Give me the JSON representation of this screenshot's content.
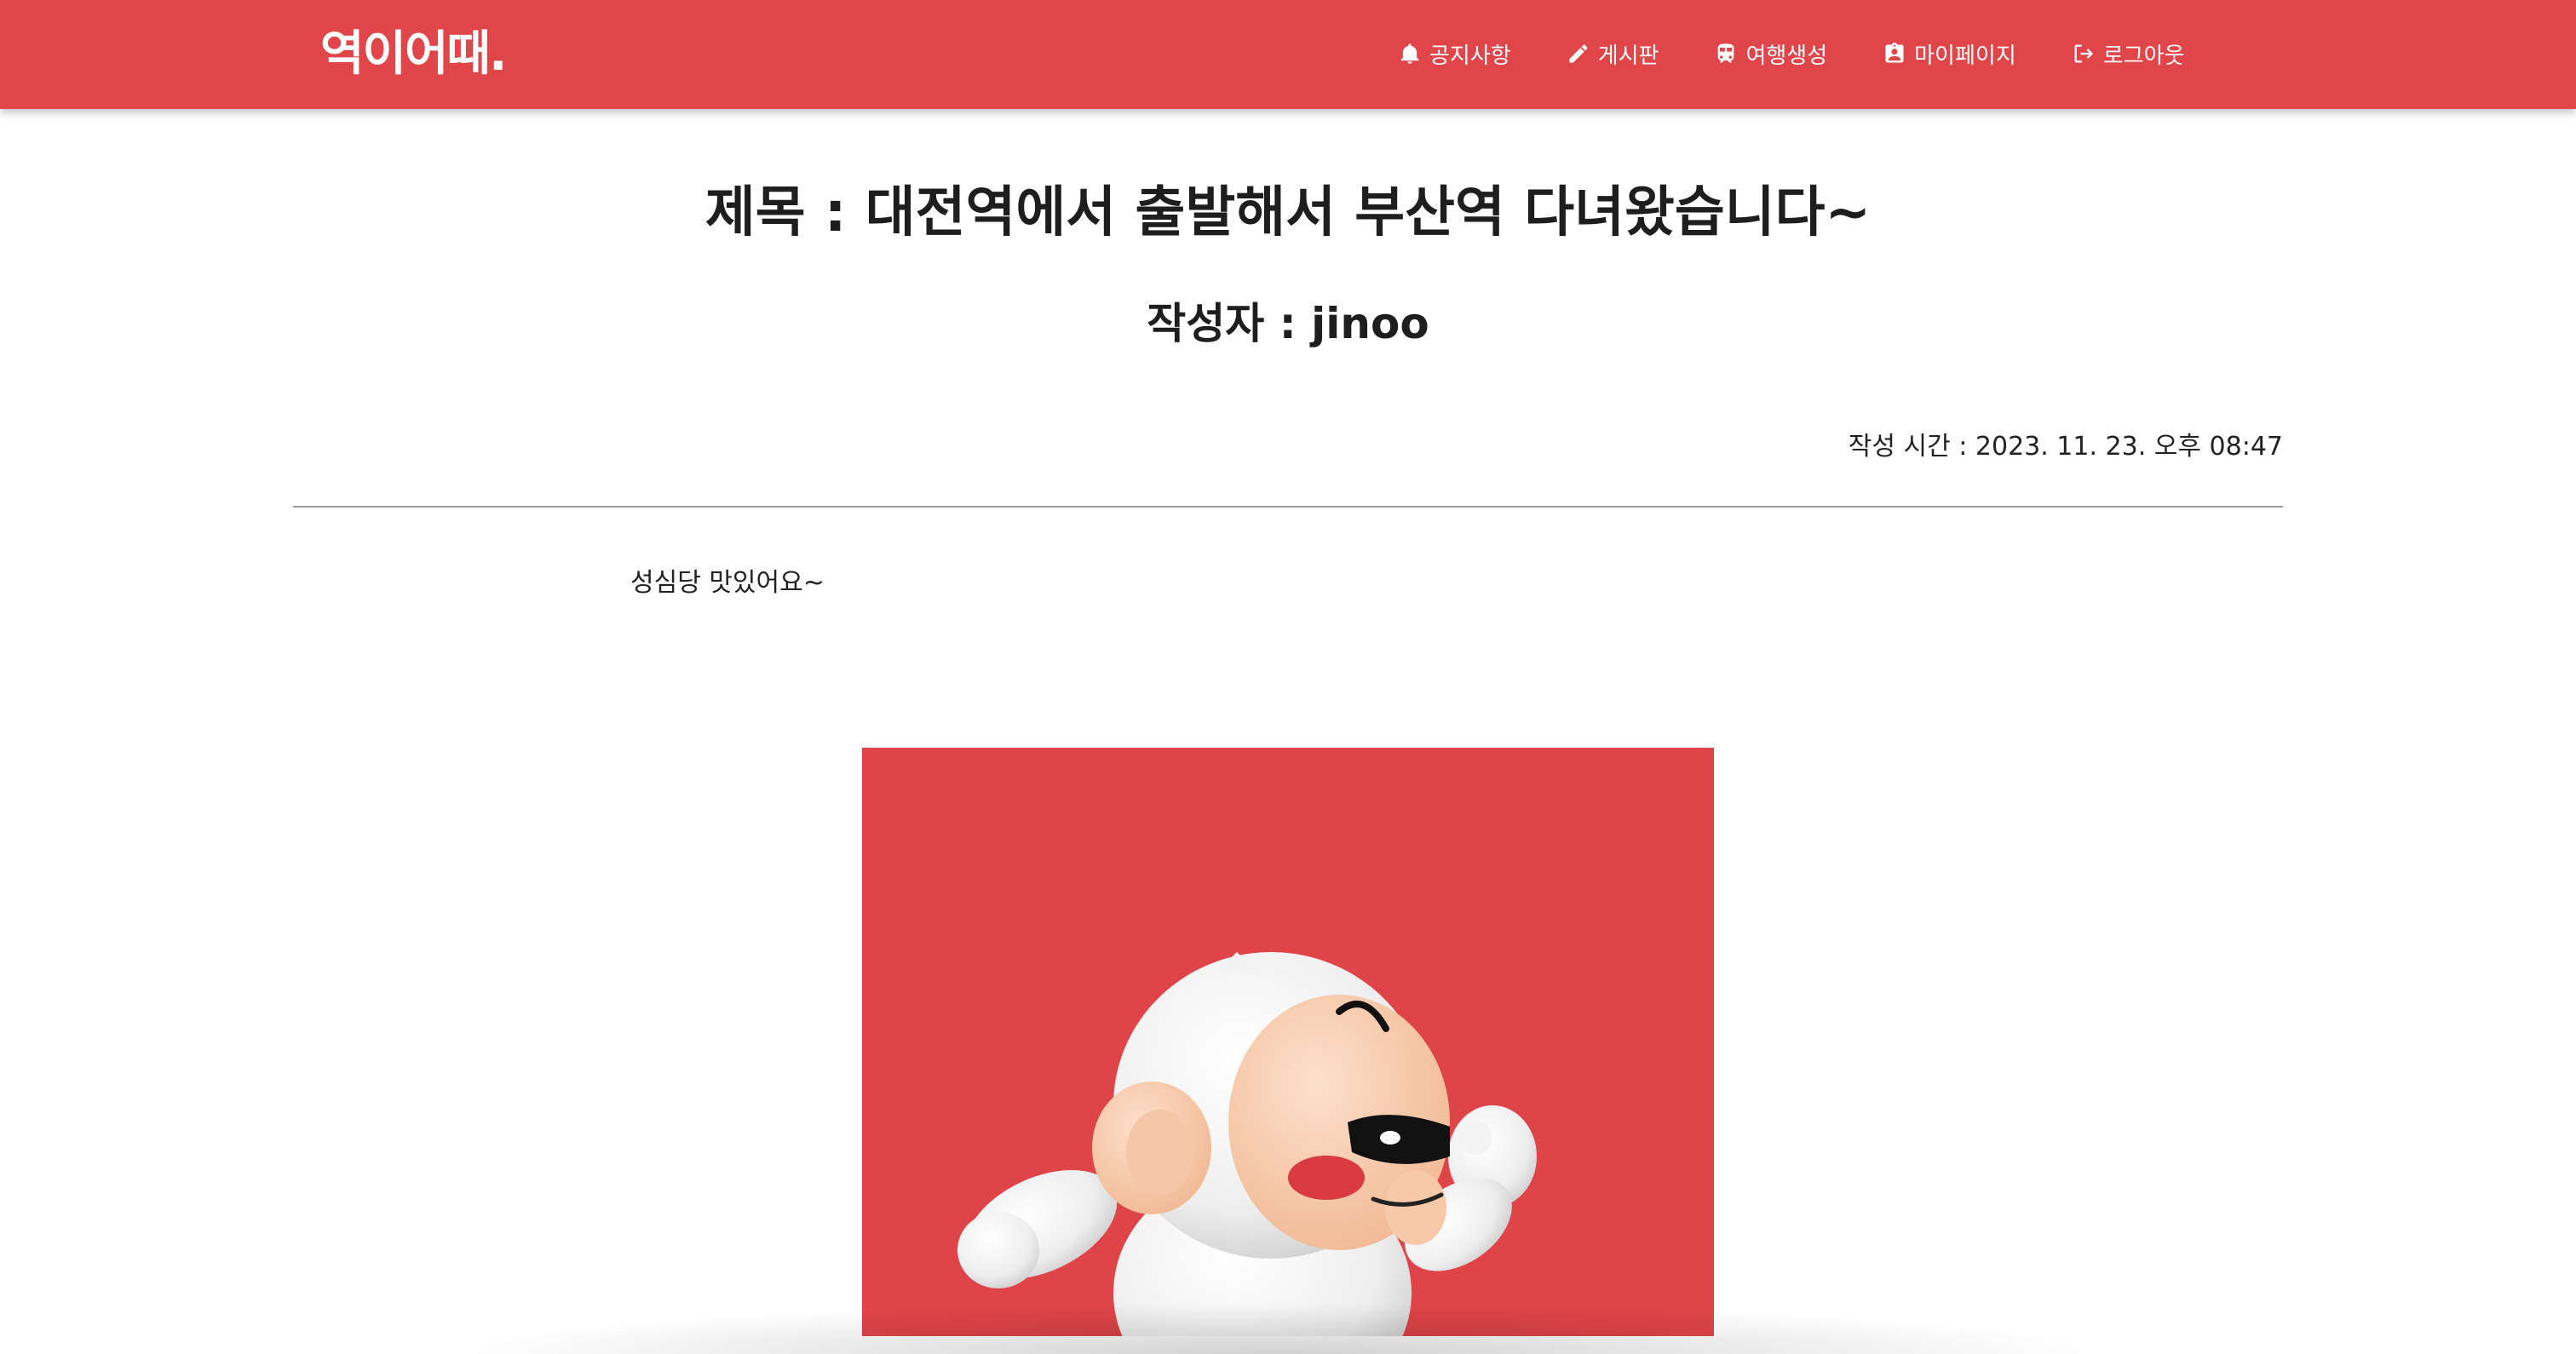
{
  "header": {
    "logo": "역이어때.",
    "nav": [
      {
        "label": "공지사항",
        "icon": "bell-icon"
      },
      {
        "label": "게시판",
        "icon": "pencil-icon"
      },
      {
        "label": "여행생성",
        "icon": "train-icon"
      },
      {
        "label": "마이페이지",
        "icon": "contact-card-icon"
      },
      {
        "label": "로그아웃",
        "icon": "logout-icon"
      }
    ],
    "accent_color": "#e0454a"
  },
  "post": {
    "title": "제목 : 대전역에서 출발해서 부산역 다녀왔습니다~",
    "author_label": "작성자 : ",
    "author": "jinoo",
    "time_label": "작성 시간 : ",
    "time": "2023. 11. 23. 오후 08:47",
    "body": "성심당 맛있어요~",
    "image": {
      "subject": "white monkey mascot character",
      "background_color": "#df4449"
    }
  }
}
